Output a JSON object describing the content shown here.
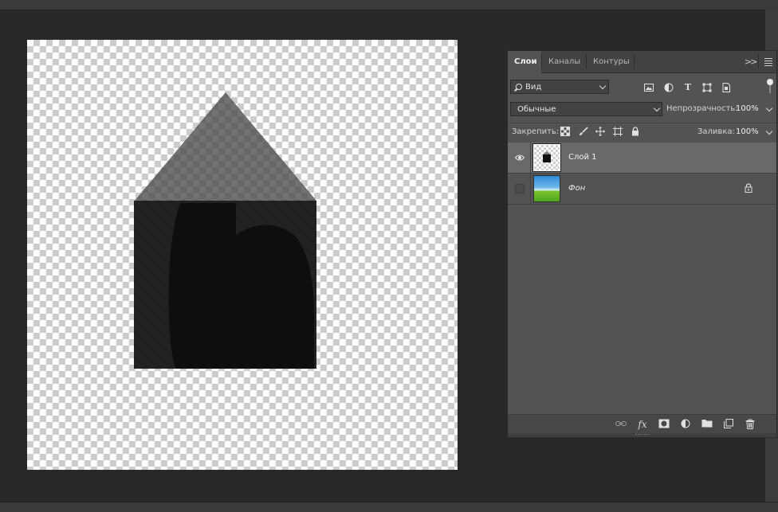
{
  "panel": {
    "tabs": [
      {
        "label": "Слои",
        "active": true
      },
      {
        "label": "Каналы",
        "active": false
      },
      {
        "label": "Контуры",
        "active": false
      }
    ],
    "filter": {
      "label": "Вид",
      "icon": "search-icon"
    },
    "filter_icons": [
      "image-filter-icon",
      "adjustment-filter-icon",
      "type-filter-icon",
      "shape-filter-icon",
      "smart-object-filter-icon"
    ],
    "blend_mode": "Обычные",
    "opacity_label": "Непрозрачность:",
    "opacity_value": "100%",
    "lock_label": "Закрепить:",
    "lock_icons": [
      "lock-transparent-icon",
      "lock-image-icon",
      "lock-position-icon",
      "lock-artboard-icon",
      "lock-all-icon"
    ],
    "fill_label": "Заливка:",
    "fill_value": "100%",
    "layers": [
      {
        "name": "Слой 1",
        "visible": true,
        "selected": true
      },
      {
        "name": "Фон",
        "visible": false,
        "selected": false,
        "locked": true
      }
    ],
    "footer_icons": [
      "link-layers-icon",
      "fx-icon",
      "mask-icon",
      "adjustment-layer-icon",
      "group-folder-icon",
      "new-layer-icon",
      "trash-icon"
    ]
  },
  "colors": {
    "app_bg": "#282828",
    "panel_bg": "#535353",
    "selected_layer": "#696969"
  }
}
